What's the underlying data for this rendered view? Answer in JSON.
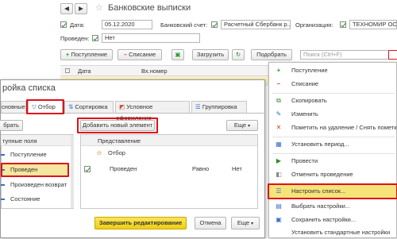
{
  "header": {
    "title": "Банковские выписки",
    "date_label": "Дата:",
    "date_value": "05.12.2020",
    "account_label": "Банковский счет:",
    "account_value": "Расчетный Сбербанк р...",
    "org_label": "Организация:",
    "org_value": "ТЕХНОМИР ООО",
    "posted_label": "Проведен:",
    "posted_value": "Нет"
  },
  "toolbar": {
    "income_label": "Поступление",
    "expense_label": "Списание",
    "load_label": "Загрузить",
    "select_label": "Подобрать",
    "search_placeholder": "Поиск (Ctrl+F)"
  },
  "table": {
    "headers": [
      "Дата",
      "Вх.номер"
    ]
  },
  "dialog": {
    "title": "ройка списка",
    "tabs": [
      "сновные",
      "Отбор",
      "Сортировка",
      "Условное оформление",
      "Группировка"
    ],
    "pick_button": "брать",
    "available_header": "тупные поля",
    "available_fields": [
      "Поступление",
      "Проведен",
      "Произведен возврат",
      "Состояние"
    ],
    "add_element_button": "Добавить новый элемент",
    "more_button": "Еще",
    "presentation_header": "Представление",
    "filter_group": "Отбор",
    "filter_row": {
      "field": "Проведен",
      "condition": "Равно",
      "value": "Нет"
    },
    "finish_button": "Завершить редактирование",
    "cancel_button": "Отмена",
    "more_button_2": "Еще"
  },
  "context_menu": {
    "items": [
      {
        "label": "Поступление",
        "icon": "+"
      },
      {
        "label": "Списание",
        "icon": "–"
      },
      {
        "label": "Скопировать",
        "icon": "⧉"
      },
      {
        "label": "Изменить",
        "icon": "✎"
      },
      {
        "label": "Пометить на удаление / Снять пометку",
        "icon": "✕"
      },
      {
        "label": "Установить период...",
        "icon": "▦"
      },
      {
        "label": "Провести",
        "icon": "▶"
      },
      {
        "label": "Отменить проведение",
        "icon": "◧"
      },
      {
        "label": "Настроить список...",
        "icon": "☰"
      },
      {
        "label": "Выбрать настройки...",
        "icon": "▤"
      },
      {
        "label": "Сохранить настройки...",
        "icon": "▣"
      },
      {
        "label": "Установить стандартные настройки",
        "icon": ""
      }
    ]
  },
  "colors": {
    "accent_yellow": "#f5d61d",
    "highlight_red": "#e0101a",
    "plus_green": "#2a9a2a",
    "minus_red": "#d23c3c"
  }
}
